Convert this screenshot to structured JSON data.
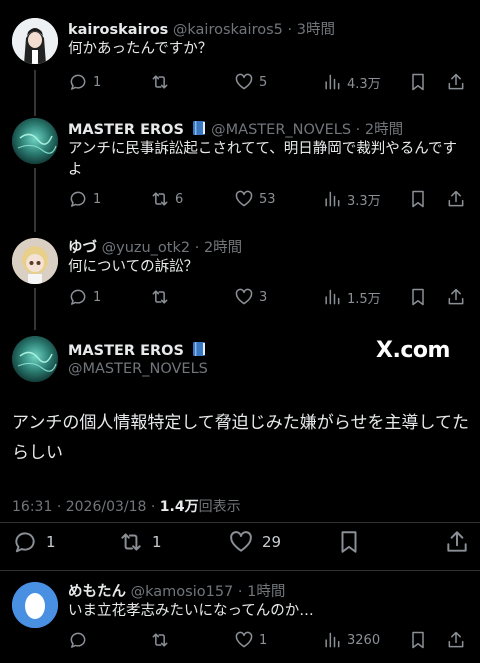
{
  "replies": [
    {
      "name": "kairoskairos",
      "handle": "@kairoskairos5",
      "time": "3時間",
      "text": "何かあったんですか？",
      "reply_count": "1",
      "retweet_count": "",
      "like_count": "5",
      "view_count": "4.3万"
    },
    {
      "name": "MASTER EROS",
      "handle": "@MASTER_NOVELS",
      "time": "2時間",
      "text": "アンチに民事訴訟起こされてて、明日静岡で裁判やるんですよ",
      "reply_count": "1",
      "retweet_count": "6",
      "like_count": "53",
      "view_count": "3.3万"
    },
    {
      "name": "ゆづ",
      "handle": "@yuzu_otk2",
      "time": "2時間",
      "text": "何についての訴訟？",
      "reply_count": "1",
      "retweet_count": "",
      "like_count": "3",
      "view_count": "1.5万"
    }
  ],
  "main_tweet": {
    "name": "MASTER EROS",
    "handle": "@MASTER_NOVELS",
    "watermark": "X.com",
    "text": "アンチの個人情報特定して脅迫じみた嫌がらせを主導してたらしい",
    "time": "16:31",
    "date": "2026/03/18",
    "views": "1.4万",
    "views_label": "回表示",
    "reply_count": "1",
    "retweet_count": "1",
    "like_count": "29"
  },
  "bottom_reply": {
    "name": "めもたん",
    "handle": "@kamosio157",
    "time": "1時間",
    "text": "いま立花孝志みたいになってんのか…",
    "reply_count": "",
    "retweet_count": "",
    "like_count": "1",
    "view_count": "3260"
  },
  "separators": {
    "dot": "·"
  },
  "icons": [
    "reply-icon",
    "retweet-icon",
    "like-icon",
    "views-icon",
    "bookmark-icon",
    "share-icon",
    "verified-book-icon"
  ]
}
